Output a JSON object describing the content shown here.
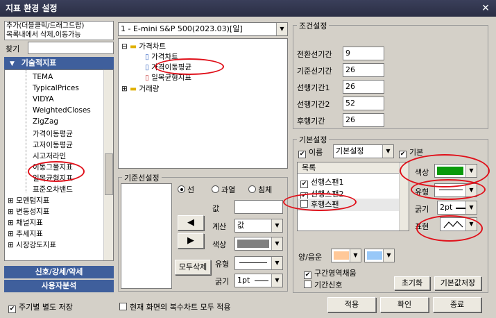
{
  "window": {
    "title": "지표 환경 설정",
    "close": "✕"
  },
  "left": {
    "hint": "추가(더블클릭/드래그드랍)\n목록내에서 삭제,이동가능",
    "search_label": "찾기",
    "category": "기술적지표",
    "items": [
      "TEMA",
      "TypicalPrices",
      "VIDYA",
      "WeightedCloses",
      "ZigZag",
      "가격이동평균",
      "고저이동평균",
      "시고저라인",
      "이동그물지표",
      "일목균형지표",
      "표준오차밴드"
    ],
    "folders": [
      "모멘텀지표",
      "변동성지표",
      "채널지표",
      "추세지표",
      "시장강도지표"
    ],
    "nav1": "신호/강세/약세",
    "nav2": "사용자분석"
  },
  "symbol": {
    "value": "1 - E-mini S&P 500(2023.03)[일]"
  },
  "tree": {
    "root1": "가격차트",
    "child1": "가격차트",
    "child2": "가격이동평균",
    "child3": "일목균형지표",
    "root2": "거래량"
  },
  "condition": {
    "title": "조건설정",
    "rows": [
      {
        "label": "전환선기간",
        "value": "9"
      },
      {
        "label": "기준선기간",
        "value": "26"
      },
      {
        "label": "선행기간1",
        "value": "26"
      },
      {
        "label": "선행기간2",
        "value": "52"
      },
      {
        "label": "후행기간",
        "value": "26"
      }
    ]
  },
  "baseline": {
    "title": "기준선설정",
    "radio_line": "선",
    "radio_over": "과열",
    "radio_under": "침체",
    "value_label": "값",
    "calc_label": "계산",
    "calc_value": "값",
    "color_label": "색상",
    "type_label": "유형",
    "thick_label": "굵기",
    "thick_value": "1pt",
    "delete_all": "모두삭제",
    "left_arrow": "◀",
    "right_arrow": "▶"
  },
  "basic": {
    "title": "기본설정",
    "name_label": "이름",
    "name_value": "기본설정",
    "base_label": "기본",
    "list_header": "목록",
    "list": [
      "선행스팬1",
      "선행스팬2",
      "후행스팬"
    ],
    "color_label": "색상",
    "type_label": "유형",
    "thick_label": "굵기",
    "thick_value": "2pt",
    "show_label": "표현",
    "updown_label": "양/음운",
    "fill_label": "구간영역채움",
    "signal_label": "기간신호",
    "reset": "초기화",
    "save_default": "기본값저장",
    "green": "#0a9a0a"
  },
  "bottom": {
    "periodic": "주기별 별도 저장",
    "apply_all": "현재 화면의 복수차트 모두 적용",
    "apply": "적용",
    "confirm": "확인",
    "close": "종료"
  }
}
